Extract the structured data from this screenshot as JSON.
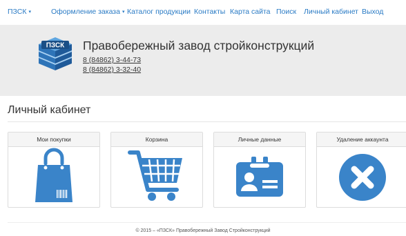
{
  "nav": {
    "items": [
      {
        "label": "ПЗСК",
        "dropdown": true
      },
      {
        "label": "Оформление заказа",
        "dropdown": true
      },
      {
        "label": "Каталог продукции",
        "dropdown": false
      },
      {
        "label": "Контакты",
        "dropdown": false
      },
      {
        "label": "Карта сайта",
        "dropdown": false
      },
      {
        "label": "Поиск",
        "dropdown": false
      },
      {
        "label": "Личный кабинет",
        "dropdown": false
      },
      {
        "label": "Выход",
        "dropdown": false
      }
    ],
    "caret": "▾"
  },
  "header": {
    "logo_text": "ПЗСК",
    "company_name": "Правобережный завод стройконструкций",
    "phones": [
      "8 (84862) 3-44-73",
      "8 (84862) 3-32-40"
    ]
  },
  "page": {
    "title": "Личный кабинет"
  },
  "cards": [
    {
      "label": "Мои покупки",
      "icon": "shopping-bag-icon"
    },
    {
      "label": "Корзина",
      "icon": "shopping-cart-icon"
    },
    {
      "label": "Личные данные",
      "icon": "id-card-icon"
    },
    {
      "label": "Удаление аккаунта",
      "icon": "delete-circle-icon"
    }
  ],
  "footer": {
    "text": "© 2015 – «ПЗСК» Правобережный Завод Стройконструкций"
  },
  "colors": {
    "accent": "#3a84c9",
    "link": "#2a7bc5",
    "band": "#ececec"
  }
}
